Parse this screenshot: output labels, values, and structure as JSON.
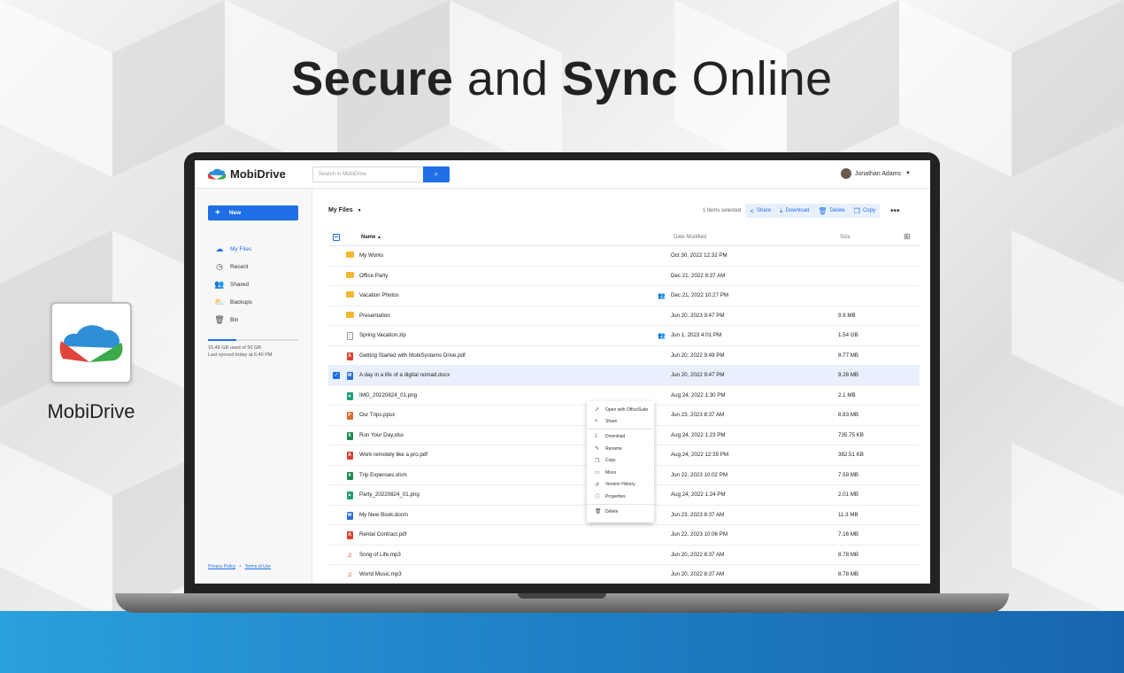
{
  "headline": {
    "part1": "Secure",
    "part2": "and",
    "part3": "Sync",
    "part4": "Online"
  },
  "brand": {
    "name": "MobiDrive"
  },
  "app": {
    "logo_text": "MobiDrive",
    "search_placeholder": "Search in MobiDrive",
    "user_name": "Jonathan Adams",
    "new_label": "New",
    "nav": [
      {
        "label": "My Files",
        "icon": "cloud-icon"
      },
      {
        "label": "Recent",
        "icon": "clock-icon"
      },
      {
        "label": "Shared",
        "icon": "people-icon"
      },
      {
        "label": "Backups",
        "icon": "backup-icon"
      },
      {
        "label": "Bin",
        "icon": "trash-icon"
      }
    ],
    "storage": {
      "used_text": "15.48 GB used of 50 GB",
      "synced_text": "Last synced today at 6:40 PM",
      "fraction": 0.31
    },
    "legal": {
      "privacy": "Privacy Policy",
      "sep": "•",
      "terms": "Terms of Use"
    },
    "breadcrumb": "My Files",
    "toolbar": {
      "selected": "1 items selected",
      "share": "Share",
      "download": "Download",
      "delete": "Delete",
      "copy": "Copy"
    },
    "columns": {
      "name": "Name",
      "date": "Date Modified",
      "size": "Size"
    },
    "files": [
      {
        "name": "My Works",
        "type": "folder",
        "date": "Oct 30, 2022 12:32 PM",
        "size": "",
        "shared": false
      },
      {
        "name": "Office Party",
        "type": "folder",
        "date": "Dec 21, 2022 8:37 AM",
        "size": "",
        "shared": false
      },
      {
        "name": "Vacation Photos",
        "type": "folder",
        "date": "Dec 21, 2022 10:27 PM",
        "size": "",
        "shared": true
      },
      {
        "name": "Presentation",
        "type": "folder",
        "date": "Jun 20, 2023 9:47 PM",
        "size": "9.9 MB",
        "shared": false
      },
      {
        "name": "Spring Vacation.zip",
        "type": "zip",
        "date": "Jun 1, 2023 4:01 PM",
        "size": "1.54 GB",
        "shared": true
      },
      {
        "name": "Getting Started with MobiSystems Drive.pdf",
        "type": "pdf",
        "date": "Jun 20, 2022 9:49 PM",
        "size": "8.77 MB",
        "shared": false
      },
      {
        "name": "A day in a life of a digital nomad.docx",
        "type": "doc",
        "date": "Jun 20, 2022 9:47 PM",
        "size": "9.28 MB",
        "shared": false,
        "selected": true
      },
      {
        "name": "IMG_20220824_01.png",
        "type": "img",
        "date": "Aug 24, 2022 1:30 PM",
        "size": "2.1 MB",
        "shared": false
      },
      {
        "name": "Our Trips.ppsx",
        "type": "ppt",
        "date": "Jun 23, 2023 8:37 AM",
        "size": "8.83 MB",
        "shared": false
      },
      {
        "name": "Run Your Day.xlsx",
        "type": "xls",
        "date": "Aug 24, 2022 1:23 PM",
        "size": "735.75 KB",
        "shared": false
      },
      {
        "name": "Work remotely like a pro.pdf",
        "type": "pdf",
        "date": "Aug 24, 2022 12:35 PM",
        "size": "382.51 KB",
        "shared": false
      },
      {
        "name": "Trip Expenses.xlsm",
        "type": "xls",
        "date": "Jun 22, 2023 10:02 PM",
        "size": "7.59 MB",
        "shared": false
      },
      {
        "name": "Party_20220824_01.png",
        "type": "img",
        "date": "Aug 24, 2022 1:24 PM",
        "size": "2.01 MB",
        "shared": false
      },
      {
        "name": "My New Book.docm",
        "type": "doc",
        "date": "Jun 23, 2023 8:37 AM",
        "size": "11.3 MB",
        "shared": false
      },
      {
        "name": "Rental Contract.pdf",
        "type": "pdf",
        "date": "Jun 22, 2023 10:06 PM",
        "size": "7.16 MB",
        "shared": false
      },
      {
        "name": "Song of Life.mp3",
        "type": "audio",
        "date": "Jun 20, 2022 8:37 AM",
        "size": "8.78 MB",
        "shared": false
      },
      {
        "name": "World Music.mp3",
        "type": "audio",
        "date": "Jun 20, 2022 8:37 AM",
        "size": "8.78 MB",
        "shared": false
      }
    ],
    "context_menu": [
      "Open with OfficeSuite",
      "Share",
      "Download",
      "Rename",
      "Copy",
      "Move",
      "Version History",
      "Properties",
      "Delete"
    ],
    "colors": {
      "accent": "#1e6fe6",
      "folder": "#f5b731",
      "pdf": "#d9412f",
      "doc": "#2b6fd6",
      "xls": "#1f8a4c",
      "ppt": "#e06a2c",
      "img": "#1f9e7a"
    }
  }
}
